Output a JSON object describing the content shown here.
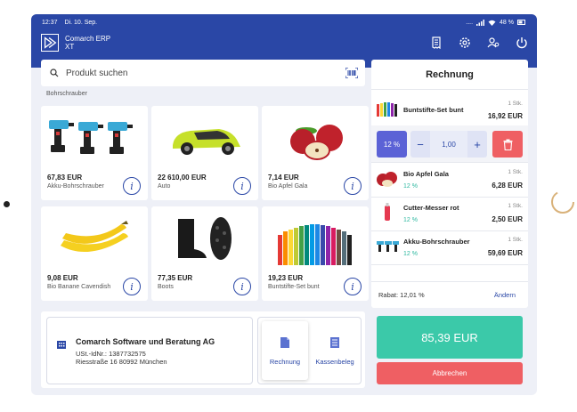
{
  "statusbar": {
    "time": "12:37",
    "date": "Di. 10. Sep.",
    "indicators": "....",
    "battery": "48 %"
  },
  "app": {
    "title_line1": "Comarch ERP",
    "title_line2": "XT"
  },
  "search": {
    "placeholder": "Produkt suchen"
  },
  "partial_row": {
    "label": "Bohrschrauber"
  },
  "products": [
    {
      "price": "67,83 EUR",
      "name": "Akku-Bohrschrauber"
    },
    {
      "price": "22 610,00 EUR",
      "name": "Auto"
    },
    {
      "price": "7,14 EUR",
      "name": "Bio Apfel Gala"
    },
    {
      "price": "9,08 EUR",
      "name": "Bio Banane Cavendish"
    },
    {
      "price": "77,35 EUR",
      "name": "Boots"
    },
    {
      "price": "19,23 EUR",
      "name": "Buntstifte-Set bunt"
    }
  ],
  "info_glyph": "i",
  "company": {
    "name": "Comarch Software und Beratung AG",
    "vat": "USt.-IdNr.: 1387732575",
    "address": "Riesstraße 16 80992 München"
  },
  "doc_types": {
    "active": "Rechnung",
    "inactive": "Kassenbeleg"
  },
  "receipt": {
    "title": "Rechnung",
    "selected": {
      "name": "Buntstifte-Set bunt",
      "qty": "1 Stk.",
      "price": "16,92 EUR"
    },
    "controls": {
      "discount": "12 %",
      "minus": "−",
      "qty": "1,00",
      "plus": "+"
    },
    "lines": [
      {
        "name": "Bio Apfel Gala",
        "qty": "1 Stk.",
        "discount": "12 %",
        "price": "6,28 EUR"
      },
      {
        "name": "Cutter-Messer rot",
        "qty": "1 Stk.",
        "discount": "12 %",
        "price": "2,50 EUR"
      },
      {
        "name": "Akku-Bohrschrauber",
        "qty": "1 Stk.",
        "discount": "12 %",
        "price": "59,69 EUR"
      }
    ],
    "rabat_label": "Rabat: 12,01 %",
    "rabat_link": "Ändern",
    "total": "85,39 EUR",
    "cancel": "Abbrechen"
  },
  "colors": {
    "brand": "#2a47a6",
    "pay": "#3bc9a9",
    "cancel": "#ef5f63",
    "discount": "#5b62d6"
  }
}
